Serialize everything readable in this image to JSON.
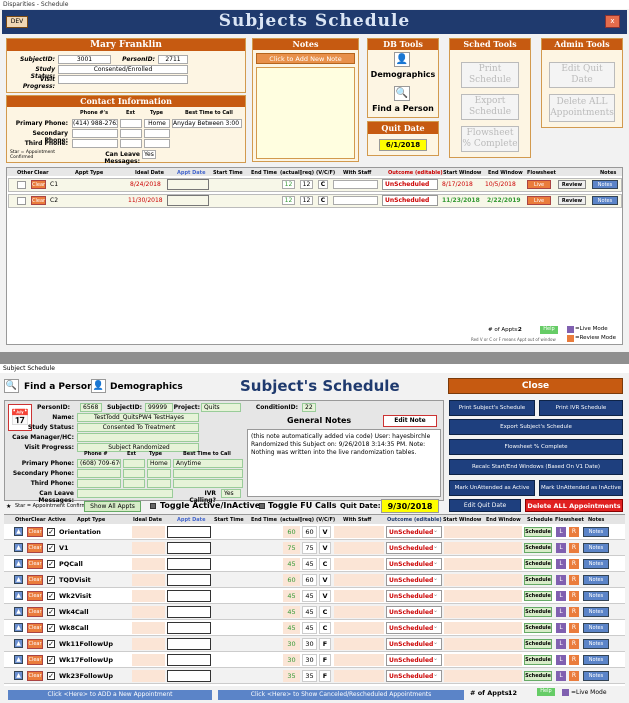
{
  "win1": {
    "title": "Disparities - Schedule",
    "dev": "DEV",
    "banner": "Subjects Schedule",
    "close": "x",
    "subject": {
      "name": "Mary  Franklin",
      "id_label": "SubjectID:",
      "id": "3001",
      "pid_label": "PersonID:",
      "pid": "2711",
      "status_label": "Study Status:",
      "status": "Consented/Enrolled",
      "visit_label": "Visit Progress:",
      "visit": ""
    },
    "contact": {
      "title": "Contact Information",
      "h_phone": "Phone #'s",
      "h_ext": "Ext",
      "h_type": "Type",
      "h_best": "Best Time to Call",
      "primary_label": "Primary Phone:",
      "primary": "(414) 988-2762",
      "ptype": "Home",
      "pbest": "Anyday Between 3:00 P",
      "secondary_label": "Secondary Phone:",
      "third_label": "Third Phone:",
      "leave_label": "Can Leave Messages:",
      "leave": "Yes",
      "star_note": "Star = Appointment Confirmed"
    },
    "notes": {
      "title": "Notes",
      "btn": "Click to Add New Note"
    },
    "dbtools": {
      "title": "DB Tools",
      "demographics": "Demographics",
      "find": "Find a Person"
    },
    "quit": {
      "title": "Quit Date",
      "value": "6/1/2018"
    },
    "sched": {
      "title": "Sched Tools",
      "print": "Print Schedule",
      "export": "Export Schedule",
      "flow": "Flowsheet % Complete"
    },
    "admin": {
      "title": "Admin Tools",
      "edit": "Edit Quit Date",
      "delete": "Delete ALL Appointments"
    },
    "cols": {
      "other": "Other",
      "clear": "Clear",
      "type": "Appt Type",
      "ideal": "Ideal Date",
      "appt": "Appt Date",
      "start": "Start Time",
      "end": "End Time",
      "actual": "(actual)",
      "req": "(req)",
      "vcf": "(V/C/F)",
      "staff": "With Staff",
      "outcome": "Outcome (editable)",
      "sw": "Start Window",
      "ew": "End Window",
      "flow": "Flowsheet",
      "notes": "Notes"
    },
    "rows": [
      {
        "clear": "Clear",
        "type": "C1",
        "ideal": "8/24/2018",
        "actual": "12",
        "req": "12",
        "vcf": "C",
        "outcome": "UnScheduled",
        "sw": "8/17/2018",
        "ew": "10/5/2018",
        "live": "Live",
        "review": "Review",
        "notes": "Notes"
      },
      {
        "clear": "Clear",
        "type": "C2",
        "ideal": "11/30/2018",
        "actual": "12",
        "req": "12",
        "vcf": "C",
        "outcome": "UnScheduled",
        "sw": "11/23/2018",
        "ew": "2/22/2019",
        "live": "Live",
        "review": "Review",
        "notes": "Notes"
      }
    ],
    "footer": {
      "appts_label": "# of Appts:",
      "appts": "2",
      "help": "Help",
      "live": "=Live Mode",
      "review": "=Review Mode",
      "redv": "Red V or C or F means Appt out of window"
    }
  },
  "win2": {
    "title": "Subject Schedule",
    "find": "Find a Person",
    "demographics": "Demographics",
    "heading": "Subject's Schedule",
    "close": "Close",
    "subject": {
      "pid_label": "PersonID:",
      "pid": "6568",
      "sid_label": "SubjectID:",
      "sid": "99999",
      "project_label": "Project:",
      "project": "Quits",
      "cond_label": "ConditionID:",
      "cond": "22",
      "name_label": "Name:",
      "name": "TestTodd_QuitsPW4 TestHayes",
      "status_label": "Study Status:",
      "status": "Consented To Treatment",
      "cm_label": "Case Manager/HC:",
      "cm": "",
      "vp_label": "Visit Progress:",
      "vp": "Subject Randomized",
      "h_phone": "Phone #",
      "h_ext": "Ext",
      "h_type": "Type",
      "h_best": "Best Time to Call",
      "primary_label": "Primary Phone:",
      "primary": "(608) 709-6702",
      "ptype": "Home",
      "pbest": "Anytime",
      "secondary_label": "Secondary Phone:",
      "third_label": "Third Phone:",
      "leave_label": "Can Leave Messages:",
      "ivr_label": "IVR Calling?",
      "ivr": "Yes"
    },
    "notes": {
      "title": "General Notes",
      "edit": "Edit Note",
      "text": "(this note automatically added via code) User: hayesbirchle Randomized this Subject on: 9/26/2018 3:14:35 PM.  Note: Nothing was written into the live randomization tables."
    },
    "buttons": {
      "print_sched": "Print Subject's Schedule",
      "print_ivr": "Print IVR Schedule",
      "export": "Export Subject's Schedule",
      "flow": "Flowsheet % Complete",
      "recalc": "Recalc Start/End Windows (Based On V1 Date)",
      "mark_active": "Mark UnAttended as Active",
      "mark_inactive": "Mark UnAttended as InActive",
      "edit_quit": "Edit Quit Date",
      "delete_all": "Delete ALL Appointments"
    },
    "star_note": "Star = Appointment Confirmed",
    "show_all": "Show All Appts",
    "toggle_active": "Toggle Active/InActive",
    "toggle_fu": "Toggle FU Calls",
    "quit_label": "Quit Date:",
    "quit": "9/30/2018",
    "cols": {
      "other": "Other",
      "clear": "Clear",
      "active": "Active",
      "type": "Appt Type",
      "ideal": "Ideal Date",
      "appt": "Appt Date",
      "start": "Start Time",
      "end": "End Time",
      "actual": "(actual)",
      "req": "(req)",
      "vcf": "(V/C/F)",
      "staff": "With Staff",
      "outcome": "Outcome (editable)",
      "sw": "Start Window",
      "ew": "End Window",
      "schedule": "Schedule",
      "flow": "Flowsheet",
      "notes": "Notes"
    },
    "rows": [
      {
        "clear": "Clear",
        "type": "Orientation",
        "actual": "60",
        "req": "60",
        "vcf": "V",
        "outcome": "UnScheduled",
        "sched": "Schedule",
        "l": "L",
        "r": "R",
        "notes": "Notes"
      },
      {
        "clear": "Clear",
        "type": "V1",
        "actual": "75",
        "req": "75",
        "vcf": "V",
        "outcome": "UnScheduled",
        "sched": "Schedule",
        "l": "L",
        "r": "R",
        "notes": "Notes"
      },
      {
        "clear": "Clear",
        "type": "PQCall",
        "actual": "45",
        "req": "45",
        "vcf": "C",
        "outcome": "UnScheduled",
        "sched": "Schedule",
        "l": "L",
        "r": "R",
        "notes": "Notes"
      },
      {
        "clear": "Clear",
        "type": "TQDVisit",
        "actual": "60",
        "req": "60",
        "vcf": "V",
        "outcome": "UnScheduled",
        "sched": "Schedule",
        "l": "L",
        "r": "R",
        "notes": "Notes"
      },
      {
        "clear": "Clear",
        "type": "Wk2Visit",
        "actual": "45",
        "req": "45",
        "vcf": "V",
        "outcome": "UnScheduled",
        "sched": "Schedule",
        "l": "L",
        "r": "R",
        "notes": "Notes"
      },
      {
        "clear": "Clear",
        "type": "Wk4Call",
        "actual": "45",
        "req": "45",
        "vcf": "C",
        "outcome": "UnScheduled",
        "sched": "Schedule",
        "l": "L",
        "r": "R",
        "notes": "Notes"
      },
      {
        "clear": "Clear",
        "type": "Wk8Call",
        "actual": "45",
        "req": "45",
        "vcf": "C",
        "outcome": "UnScheduled",
        "sched": "Schedule",
        "l": "L",
        "r": "R",
        "notes": "Notes"
      },
      {
        "clear": "Clear",
        "type": "Wk11FollowUp",
        "actual": "30",
        "req": "30",
        "vcf": "F",
        "outcome": "UnScheduled",
        "sched": "Schedule",
        "l": "L",
        "r": "R",
        "notes": "Notes"
      },
      {
        "clear": "Clear",
        "type": "Wk17FollowUp",
        "actual": "30",
        "req": "30",
        "vcf": "F",
        "outcome": "UnScheduled",
        "sched": "Schedule",
        "l": "L",
        "r": "R",
        "notes": "Notes"
      },
      {
        "clear": "Clear",
        "type": "Wk23FollowUp",
        "actual": "35",
        "req": "35",
        "vcf": "F",
        "outcome": "UnScheduled",
        "sched": "Schedule",
        "l": "L",
        "r": "R",
        "notes": "Notes"
      }
    ],
    "footer": {
      "add": "Click <Here> to ADD a New Appointment",
      "show_cancelled": "Click <Here> to Show Canceled/Rescheduled Appointments",
      "appts_label": "# of Appts:",
      "appts": "12",
      "help": "Help",
      "live": "=Live Mode"
    }
  }
}
